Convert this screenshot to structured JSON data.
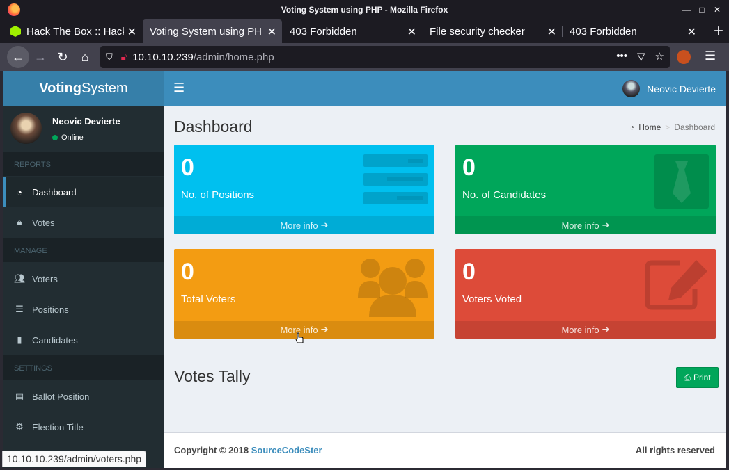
{
  "browser": {
    "window_title": "Voting System using PHP - Mozilla Firefox",
    "tabs": [
      {
        "label": "Hack The Box :: Hack",
        "active": false
      },
      {
        "label": "Voting System using PH",
        "active": true
      },
      {
        "label": "403 Forbidden",
        "active": false
      },
      {
        "label": "File security checker",
        "active": false
      },
      {
        "label": "403 Forbidden",
        "active": false
      }
    ],
    "url_host": "10.10.10.239",
    "url_path": "/admin/home.php",
    "status_url": "10.10.10.239/admin/voters.php"
  },
  "app": {
    "logo_bold": "Voting",
    "logo_rest": "System",
    "user_name": "Neovic Devierte",
    "user_status": "Online"
  },
  "sidebar": {
    "headers": [
      "REPORTS",
      "MANAGE",
      "SETTINGS"
    ],
    "items": [
      {
        "label": "Dashboard",
        "icon": "dashboard-icon"
      },
      {
        "label": "Votes",
        "icon": "lock-icon"
      },
      {
        "label": "Voters",
        "icon": "users-icon"
      },
      {
        "label": "Positions",
        "icon": "list-icon"
      },
      {
        "label": "Candidates",
        "icon": "person-icon"
      },
      {
        "label": "Ballot Position",
        "icon": "file-icon"
      },
      {
        "label": "Election Title",
        "icon": "gear-icon"
      }
    ]
  },
  "main": {
    "title": "Dashboard",
    "breadcrumb": {
      "home": "Home",
      "current": "Dashboard"
    },
    "boxes": [
      {
        "value": "0",
        "label": "No. of Positions",
        "more": "More info",
        "color": "#00c0ef"
      },
      {
        "value": "0",
        "label": "No. of Candidates",
        "more": "More info",
        "color": "#00a65a"
      },
      {
        "value": "0",
        "label": "Total Voters",
        "more": "More info",
        "color": "#f39c12"
      },
      {
        "value": "0",
        "label": "Voters Voted",
        "more": "More info",
        "color": "#dd4b39"
      }
    ],
    "tally_title": "Votes Tally",
    "print_label": "Print"
  },
  "footer": {
    "copyright": "Copyright © 2018",
    "link": "SourceCodeSter",
    "rights": "All rights reserved"
  }
}
